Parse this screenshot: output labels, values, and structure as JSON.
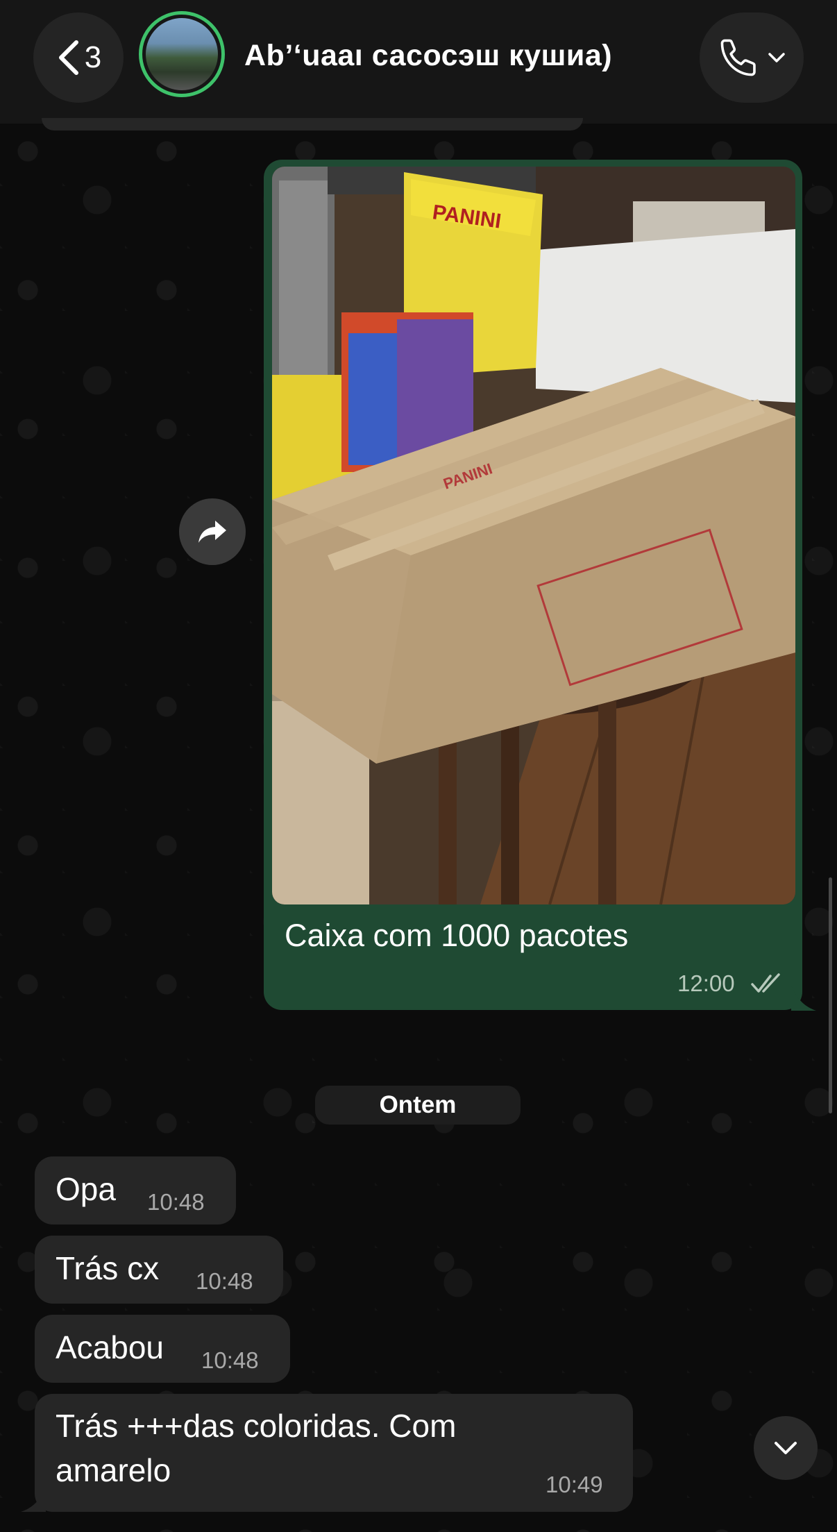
{
  "header": {
    "back_count": "3",
    "contact_name": "Ab’ʻuааı сасосэш кушиа)",
    "icons": {
      "back": "chevron-left-icon",
      "call": "phone-icon",
      "call_menu": "chevron-down-icon"
    }
  },
  "outgoing_message": {
    "caption": "Caixa com 1000 pacotes",
    "time": "12:00",
    "status_icon": "double-check-icon",
    "photo_texts": {
      "panini_sign": "PANINI",
      "box_brand": "PANINI"
    }
  },
  "date_separator": "Ontem",
  "incoming_messages": [
    {
      "text": "Opa",
      "time": "10:48"
    },
    {
      "text": "Trás cx",
      "time": "10:48"
    },
    {
      "text": "Acabou",
      "time": "10:48"
    },
    {
      "text_line1": "Trás +++das coloridas.  Com",
      "text_line2": "amarelo",
      "time": "10:49"
    }
  ],
  "colors": {
    "outgoing_bubble": "#1f4a33",
    "incoming_bubble": "#262626",
    "avatar_ring": "#3ec26a"
  }
}
